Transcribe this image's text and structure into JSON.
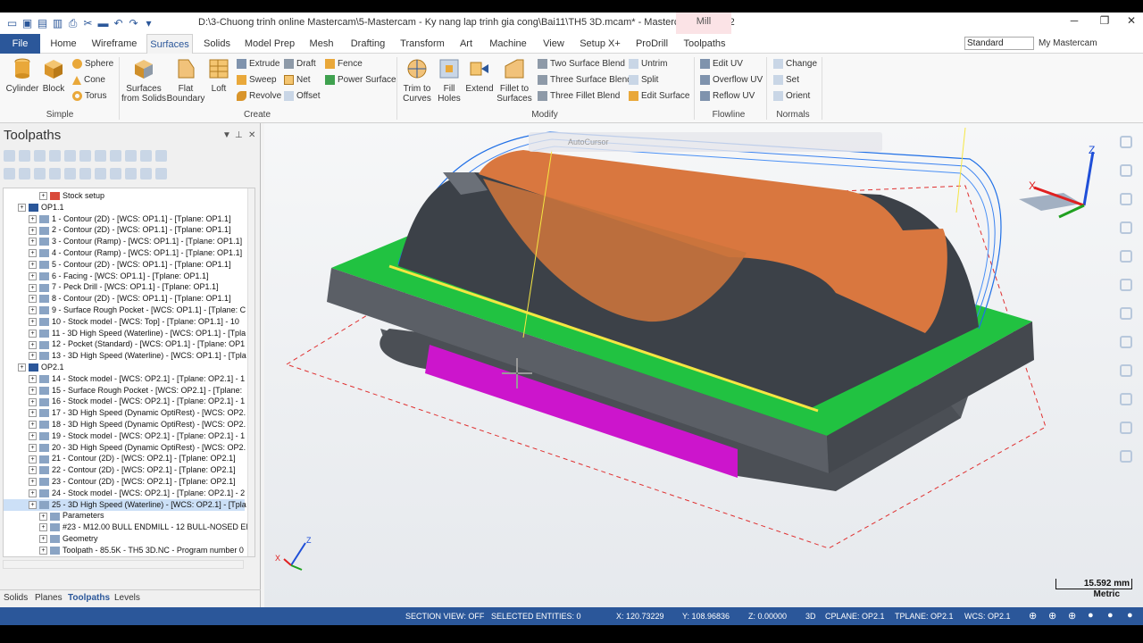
{
  "titlebar": {
    "path": "D:\\3-Chuong trinh online Mastercam\\5-Mastercam - Ky nang lap trinh gia cong\\Bai11\\TH5 3D.mcam* - Mastercam Mill 2022",
    "context_tab": "Mill"
  },
  "menu": {
    "file": "File",
    "home": "Home",
    "wireframe": "Wireframe",
    "surfaces": "Surfaces",
    "solids": "Solids",
    "model_prep": "Model Prep",
    "mesh": "Mesh",
    "drafting": "Drafting",
    "transform": "Transform",
    "art": "Art",
    "machine": "Machine",
    "view": "View",
    "setup_x": "Setup X+",
    "prodrill": "ProDrill",
    "toolpaths": "Toolpaths",
    "standard": "Standard",
    "my_mastercam": "My Mastercam"
  },
  "ribbon": {
    "simple": {
      "label": "Simple",
      "cylinder": "Cylinder",
      "block": "Block",
      "sphere": "Sphere",
      "cone": "Cone",
      "torus": "Torus"
    },
    "create": {
      "label": "Create",
      "surfaces_from_solids": [
        "Surfaces",
        "from Solids"
      ],
      "flat_boundary": [
        "Flat",
        "Boundary"
      ],
      "loft": "Loft",
      "extrude": "Extrude",
      "sweep": "Sweep",
      "revolve": "Revolve",
      "draft": "Draft",
      "net": "Net",
      "offset": "Offset",
      "fence": "Fence",
      "power_surface": "Power Surface"
    },
    "modify": {
      "label": "Modify",
      "trim_to_curves": [
        "Trim to",
        "Curves"
      ],
      "fill_holes": [
        "Fill",
        "Holes"
      ],
      "extend": "Extend",
      "fillet_to_surfaces": [
        "Fillet to",
        "Surfaces"
      ],
      "two_surface_blend": "Two Surface Blend",
      "three_surface_blend": "Three Surface Blend",
      "three_fillet_blend": "Three Fillet Blend",
      "untrim": "Untrim",
      "split": "Split",
      "edit_surface": "Edit Surface"
    },
    "flowline": {
      "label": "Flowline",
      "edit_uv": "Edit UV",
      "overflow_uv": "Overflow UV",
      "reflow_uv": "Reflow UV"
    },
    "normals": {
      "label": "Normals",
      "change": "Change",
      "set": "Set",
      "orient": "Orient"
    }
  },
  "panel": {
    "title": "Toolpaths",
    "tree": [
      {
        "text": "Stock setup",
        "indent": 3
      },
      {
        "text": "OP1.1",
        "indent": 1
      },
      {
        "text": "1 - Contour (2D) - [WCS: OP1.1] - [Tplane: OP1.1]",
        "indent": 2
      },
      {
        "text": "2 - Contour (2D) - [WCS: OP1.1] - [Tplane: OP1.1]",
        "indent": 2
      },
      {
        "text": "3 - Contour (Ramp) - [WCS: OP1.1] - [Tplane: OP1.1]",
        "indent": 2
      },
      {
        "text": "4 - Contour (Ramp) - [WCS: OP1.1] - [Tplane: OP1.1]",
        "indent": 2
      },
      {
        "text": "5 - Contour (2D) - [WCS: OP1.1] - [Tplane: OP1.1]",
        "indent": 2
      },
      {
        "text": "6 - Facing - [WCS: OP1.1] - [Tplane: OP1.1]",
        "indent": 2
      },
      {
        "text": "7 - Peck Drill - [WCS: OP1.1] - [Tplane: OP1.1]",
        "indent": 2
      },
      {
        "text": "8 - Contour (2D) - [WCS: OP1.1] - [Tplane: OP1.1]",
        "indent": 2
      },
      {
        "text": "9 - Surface Rough Pocket - [WCS: OP1.1] - [Tplane: C",
        "indent": 2
      },
      {
        "text": "10 - Stock model - [WCS: Top] - [Tplane: OP1.1] - 10",
        "indent": 2
      },
      {
        "text": "11 - 3D High Speed (Waterline) - [WCS: OP1.1] - [Tpla",
        "indent": 2
      },
      {
        "text": "12 - Pocket (Standard) - [WCS: OP1.1] - [Tplane: OP1",
        "indent": 2
      },
      {
        "text": "13 - 3D High Speed (Waterline) - [WCS: OP1.1] - [Tpla",
        "indent": 2
      },
      {
        "text": "OP2.1",
        "indent": 1
      },
      {
        "text": "14 - Stock model - [WCS: OP2.1] - [Tplane: OP2.1] - 1",
        "indent": 2
      },
      {
        "text": "15 - Surface Rough Pocket - [WCS: OP2.1] - [Tplane:",
        "indent": 2
      },
      {
        "text": "16 - Stock model - [WCS: OP2.1] - [Tplane: OP2.1] - 1",
        "indent": 2
      },
      {
        "text": "17 - 3D High Speed (Dynamic OptiRest) - [WCS: OP2.",
        "indent": 2
      },
      {
        "text": "18 - 3D High Speed (Dynamic OptiRest) - [WCS: OP2.",
        "indent": 2
      },
      {
        "text": "19 - Stock model - [WCS: OP2.1] - [Tplane: OP2.1] - 1",
        "indent": 2
      },
      {
        "text": "20 - 3D High Speed (Dynamic OptiRest) - [WCS: OP2.",
        "indent": 2
      },
      {
        "text": "21 - Contour (2D) - [WCS: OP2.1] - [Tplane: OP2.1]",
        "indent": 2
      },
      {
        "text": "22 - Contour (2D) - [WCS: OP2.1] - [Tplane: OP2.1]",
        "indent": 2
      },
      {
        "text": "23 - Contour (2D) - [WCS: OP2.1] - [Tplane: OP2.1]",
        "indent": 2
      },
      {
        "text": "24 - Stock model - [WCS: OP2.1] - [Tplane: OP2.1] - 2",
        "indent": 2
      },
      {
        "text": "25 - 3D High Speed (Waterline) - [WCS: OP2.1] - [Tpla",
        "indent": 2,
        "selected": true
      },
      {
        "text": "Parameters",
        "indent": 3
      },
      {
        "text": "#23 - M12.00 BULL ENDMILL - 12 BULL-NOSED EN",
        "indent": 3
      },
      {
        "text": "Geometry",
        "indent": 3
      },
      {
        "text": "Toolpath - 85.5K - TH5 3D.NC - Program number 0",
        "indent": 3
      }
    ],
    "tabs": {
      "solids": "Solids",
      "planes": "Planes",
      "toolpaths": "Toolpaths",
      "levels": "Levels"
    }
  },
  "viewport": {
    "autocursor": "AutoCursor",
    "scale": "15.592 mm",
    "units": "Metric",
    "axes": {
      "x": "X",
      "y": "Y",
      "z": "Z"
    }
  },
  "status": {
    "section_view": "SECTION VIEW: OFF",
    "selected": "SELECTED ENTITIES: 0",
    "x": "X:  120.73229",
    "y": "Y:  108.96836",
    "z": "Z:  0.00000",
    "mode": "3D",
    "cplane": "CPLANE: OP2.1",
    "tplane": "TPLANE: OP2.1",
    "wcs": "WCS: OP2.1"
  },
  "colors": {
    "accent": "#2b579a",
    "stock_green": "#21c241",
    "cut_orange": "#d9773f",
    "magenta": "#cc15cc",
    "toolpath_blue": "#1f6fe6"
  }
}
